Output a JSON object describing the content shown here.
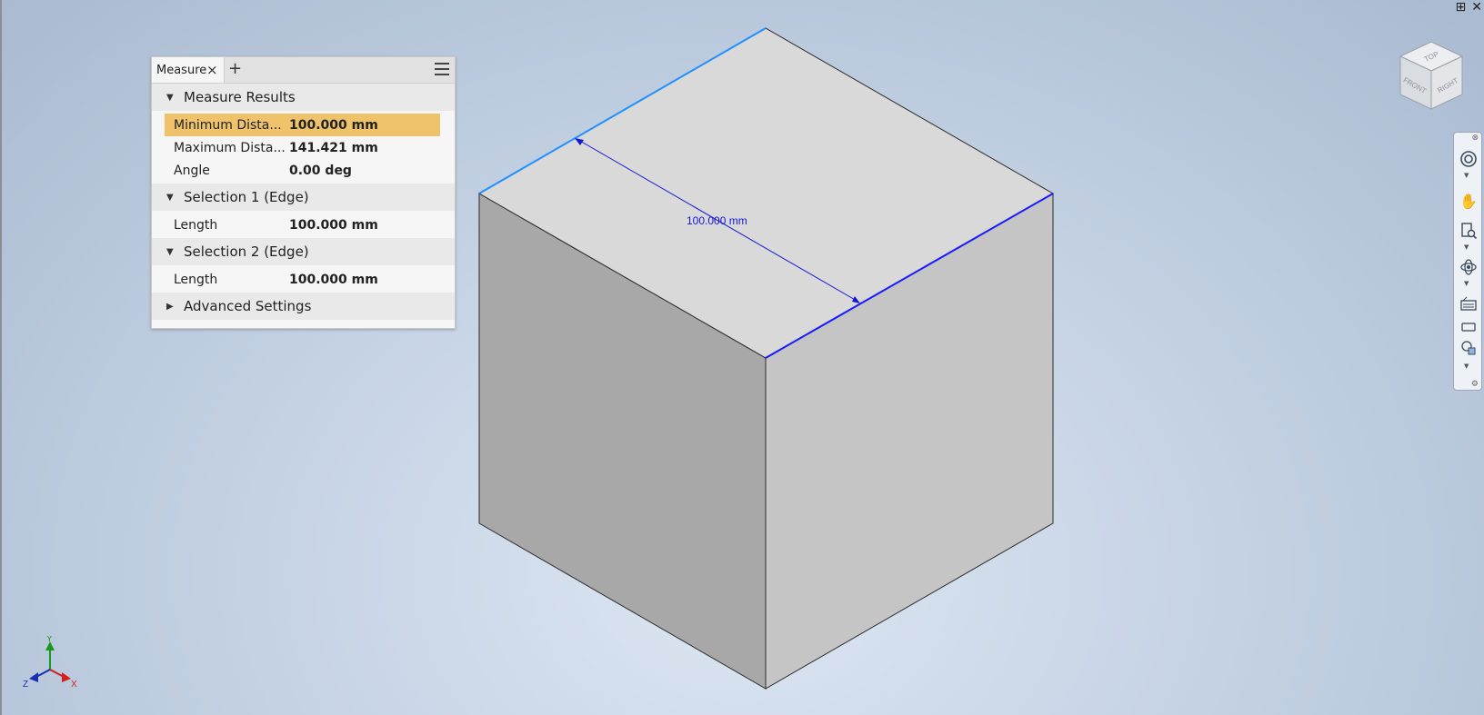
{
  "viewport": {
    "dimension_label": "100.000 mm"
  },
  "measure_panel": {
    "tab_label": "Measure",
    "close_icon": "×",
    "add_tab_icon": "+",
    "sections": [
      {
        "title": "Measure Results",
        "expanded": true,
        "rows": [
          {
            "label": "Minimum Dista...",
            "value": "100.000 mm",
            "selected": true
          },
          {
            "label": "Maximum Dista...",
            "value": "141.421 mm",
            "selected": false
          },
          {
            "label": "Angle",
            "value": "0.00 deg",
            "selected": false
          }
        ]
      },
      {
        "title": "Selection 1 (Edge)",
        "expanded": true,
        "rows": [
          {
            "label": "Length",
            "value": "100.000 mm",
            "selected": false
          }
        ]
      },
      {
        "title": "Selection 2 (Edge)",
        "expanded": true,
        "rows": [
          {
            "label": "Length",
            "value": "100.000 mm",
            "selected": false
          }
        ]
      },
      {
        "title": "Advanced Settings",
        "expanded": false,
        "rows": []
      }
    ]
  },
  "viewcube": {
    "top": "TOP",
    "front": "FRONT",
    "right": "RIGHT"
  },
  "triad": {
    "x": "X",
    "y": "Y",
    "z": "Z"
  },
  "colors": {
    "selected_row": "#efc36b",
    "edge_highlight_1": "#1e90ff",
    "edge_highlight_2": "#1a1aff",
    "dimension": "#1515d6",
    "x_axis": "#d21f1f",
    "y_axis": "#1a9a1a",
    "z_axis": "#1a2fb0"
  },
  "icons": {
    "nav_bar": [
      "steering-wheel-icon",
      "pan-icon",
      "zoom-icon",
      "orbit-icon",
      "look-at-icon",
      "full-navigation-icon"
    ]
  }
}
